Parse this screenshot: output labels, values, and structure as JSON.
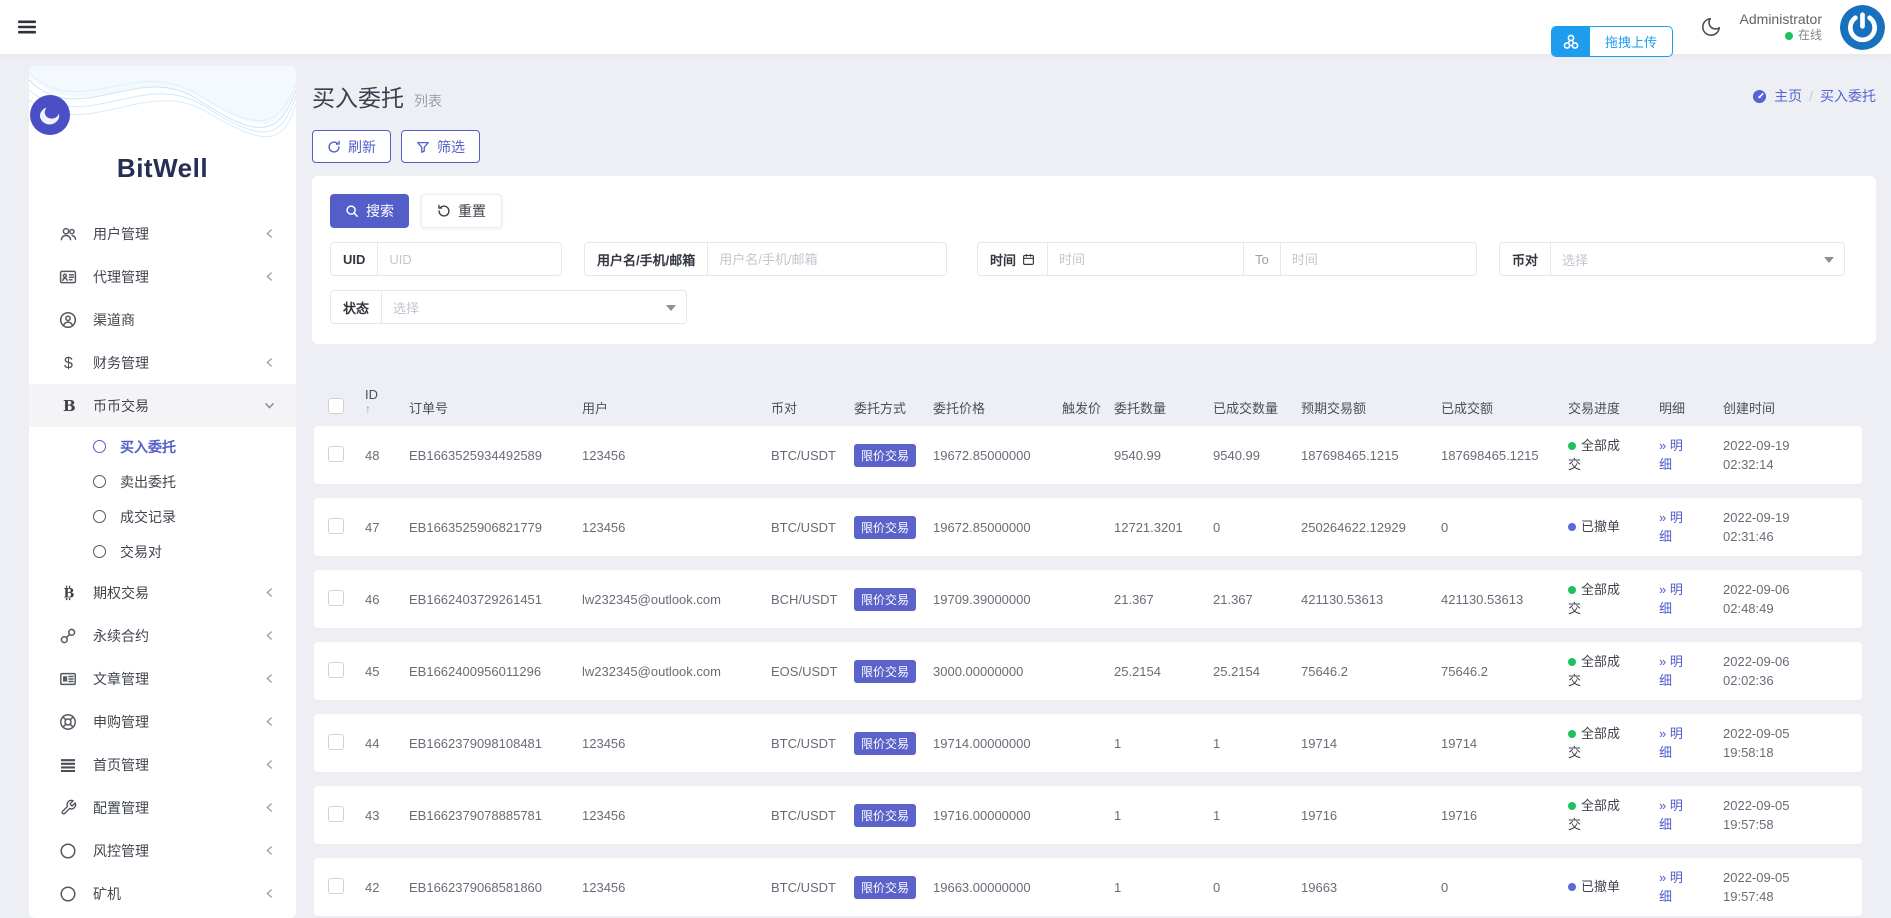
{
  "colors": {
    "primary": "#545ec9",
    "badge": "#5b62c9",
    "link": "#4c5ad0",
    "breadcrumb": "#5564d4",
    "status_done": "#1fbf62",
    "status_cancel": "#5a68d8",
    "upload_blue": "#1e9dee"
  },
  "topbar": {
    "menu_icon": "hamburger-icon",
    "theme_icon": "moon-icon",
    "user_name": "Administrator",
    "user_status": "在线",
    "avatar_icon": "power-logo-icon",
    "upload_icon": "nodes-icon",
    "upload_label": "拖拽上传"
  },
  "sidebar": {
    "brand": "BitWell",
    "items": [
      {
        "label": "用户管理",
        "icon": "users-icon",
        "chevron": "left"
      },
      {
        "label": "代理管理",
        "icon": "id-card-icon",
        "chevron": "left"
      },
      {
        "label": "渠道商",
        "icon": "user-circle-icon",
        "chevron": "none"
      },
      {
        "label": "财务管理",
        "icon": "dollar-icon",
        "chevron": "left"
      },
      {
        "label": "币币交易",
        "icon": "coin-b-icon",
        "chevron": "down",
        "active": true,
        "children": [
          {
            "label": "买入委托",
            "active": true
          },
          {
            "label": "卖出委托"
          },
          {
            "label": "成交记录"
          },
          {
            "label": "交易对"
          }
        ]
      },
      {
        "label": "期权交易",
        "icon": "bitcoin-icon",
        "chevron": "left"
      },
      {
        "label": "永续合约",
        "icon": "chain-icon",
        "chevron": "left"
      },
      {
        "label": "文章管理",
        "icon": "article-icon",
        "chevron": "left"
      },
      {
        "label": "申购管理",
        "icon": "lifering-icon",
        "chevron": "left"
      },
      {
        "label": "首页管理",
        "icon": "bars-icon",
        "chevron": "left"
      },
      {
        "label": "配置管理",
        "icon": "wrench-icon",
        "chevron": "left"
      },
      {
        "label": "风控管理",
        "icon": "circle-icon",
        "chevron": "left"
      },
      {
        "label": "矿机",
        "icon": "circle-icon",
        "chevron": "left"
      }
    ]
  },
  "page": {
    "title": "买入委托",
    "subtitle": "列表",
    "breadcrumb": {
      "home_icon": "home-icon",
      "home_label": "主页",
      "separator": "/",
      "current": "买入委托"
    },
    "refresh_label": "刷新",
    "refresh_icon": "refresh-icon",
    "filter_label": "筛选",
    "filter_icon": "funnel-icon"
  },
  "search": {
    "search_label": "搜索",
    "search_icon": "search-icon",
    "reset_label": "重置",
    "reset_icon": "reset-icon",
    "fields": {
      "uid_label": "UID",
      "uid_placeholder": "UID",
      "user_label": "用户名/手机/邮箱",
      "user_placeholder": "用户名/手机/邮箱",
      "time_label": "时间",
      "time_icon": "calendar-icon",
      "time_from_placeholder": "时间",
      "to_label": "To",
      "time_to_placeholder": "时间",
      "pair_label": "币对",
      "pair_placeholder": "选择",
      "status_label": "状态",
      "status_placeholder": "选择"
    }
  },
  "table": {
    "headers": [
      {
        "label": "ID",
        "sort_icon": "arrow-up"
      },
      {
        "label": "订单号"
      },
      {
        "label": "用户"
      },
      {
        "label": "币对"
      },
      {
        "label": "委托方式"
      },
      {
        "label": "委托价格"
      },
      {
        "label": "触发价"
      },
      {
        "label": "委托数量"
      },
      {
        "label": "已成交数量"
      },
      {
        "label": "预期交易额"
      },
      {
        "label": "已成交额"
      },
      {
        "label": "交易进度"
      },
      {
        "label": "明细"
      },
      {
        "label": "创建时间"
      }
    ],
    "detail_prefix": "»",
    "detail_label": "明细",
    "rows": [
      {
        "id": "48",
        "order_no": "EB1663525934492589",
        "user": "123456",
        "pair": "BTC/USDT",
        "order_type": "限价交易",
        "price": "19672.85000000",
        "trigger": "",
        "amount": "9540.99",
        "filled_qty": "9540.99",
        "expected": "187698465.1215",
        "filled_amount": "187698465.1215",
        "status": "全部成交",
        "status_type": "done",
        "created": "2022-09-19 02:32:14"
      },
      {
        "id": "47",
        "order_no": "EB1663525906821779",
        "user": "123456",
        "pair": "BTC/USDT",
        "order_type": "限价交易",
        "price": "19672.85000000",
        "trigger": "",
        "amount": "12721.3201",
        "filled_qty": "0",
        "expected": "250264622.12929",
        "filled_amount": "0",
        "status": "已撤单",
        "status_type": "cancel",
        "created": "2022-09-19 02:31:46"
      },
      {
        "id": "46",
        "order_no": "EB1662403729261451",
        "user": "lw232345@outlook.com",
        "pair": "BCH/USDT",
        "order_type": "限价交易",
        "price": "19709.39000000",
        "trigger": "",
        "amount": "21.367",
        "filled_qty": "21.367",
        "expected": "421130.53613",
        "filled_amount": "421130.53613",
        "status": "全部成交",
        "status_type": "done",
        "created": "2022-09-06 02:48:49"
      },
      {
        "id": "45",
        "order_no": "EB1662400956011296",
        "user": "lw232345@outlook.com",
        "pair": "EOS/USDT",
        "order_type": "限价交易",
        "price": "3000.00000000",
        "trigger": "",
        "amount": "25.2154",
        "filled_qty": "25.2154",
        "expected": "75646.2",
        "filled_amount": "75646.2",
        "status": "全部成交",
        "status_type": "done",
        "created": "2022-09-06 02:02:36"
      },
      {
        "id": "44",
        "order_no": "EB1662379098108481",
        "user": "123456",
        "pair": "BTC/USDT",
        "order_type": "限价交易",
        "price": "19714.00000000",
        "trigger": "",
        "amount": "1",
        "filled_qty": "1",
        "expected": "19714",
        "filled_amount": "19714",
        "status": "全部成交",
        "status_type": "done",
        "created": "2022-09-05 19:58:18"
      },
      {
        "id": "43",
        "order_no": "EB1662379078885781",
        "user": "123456",
        "pair": "BTC/USDT",
        "order_type": "限价交易",
        "price": "19716.00000000",
        "trigger": "",
        "amount": "1",
        "filled_qty": "1",
        "expected": "19716",
        "filled_amount": "19716",
        "status": "全部成交",
        "status_type": "done",
        "created": "2022-09-05 19:57:58"
      },
      {
        "id": "42",
        "order_no": "EB1662379068581860",
        "user": "123456",
        "pair": "BTC/USDT",
        "order_type": "限价交易",
        "price": "19663.00000000",
        "trigger": "",
        "amount": "1",
        "filled_qty": "0",
        "expected": "19663",
        "filled_amount": "0",
        "status": "已撤单",
        "status_type": "cancel",
        "created": "2022-09-05 19:57:48"
      }
    ]
  }
}
